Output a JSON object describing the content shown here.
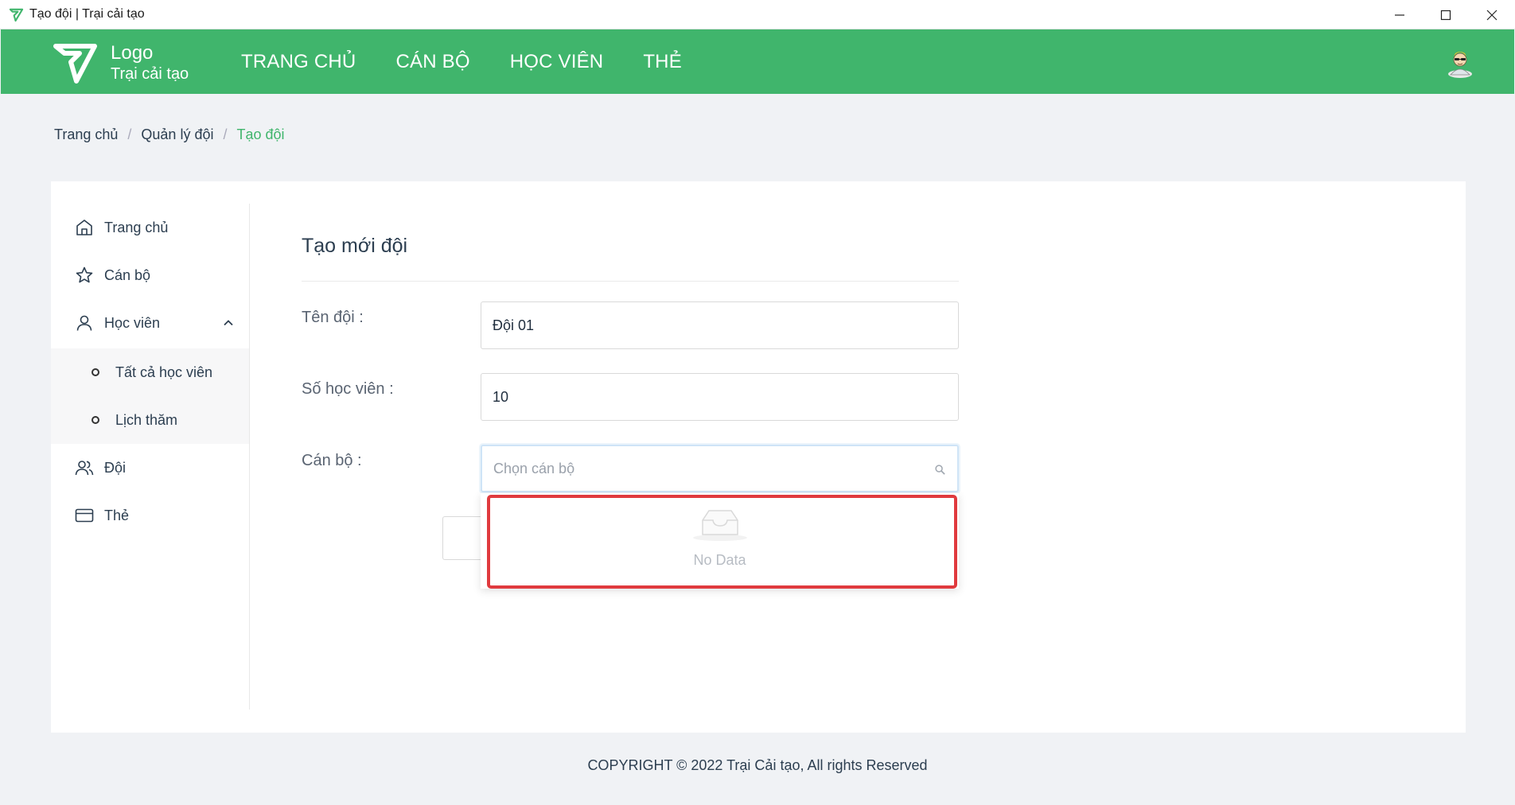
{
  "window": {
    "title": "Tạo đội | Trại cải tạo",
    "icon": "app-logo-icon",
    "controls": [
      "minimize-icon",
      "maximize-icon",
      "close-icon"
    ]
  },
  "header": {
    "logo_title": "Logo",
    "logo_subtitle": "Trại cải tạo",
    "nav": [
      "TRANG CHỦ",
      "CÁN BỘ",
      "HỌC VIÊN",
      "THẺ"
    ],
    "avatar": "avatar-icon",
    "background": "#40b56c"
  },
  "breadcrumb": {
    "items": [
      "Trang chủ",
      "Quản lý đội"
    ],
    "separator": "/",
    "current": "Tạo đội"
  },
  "sidebar": {
    "items": [
      {
        "label": "Trang chủ",
        "icon": "home-icon"
      },
      {
        "label": "Cán bộ",
        "icon": "star-icon"
      },
      {
        "label": "Học viên",
        "icon": "user-icon",
        "expanded": true
      },
      {
        "label": "Đội",
        "icon": "users-icon"
      },
      {
        "label": "Thẻ",
        "icon": "card-icon"
      }
    ],
    "subitems": [
      "Tất cả học viên",
      "Lịch thăm"
    ]
  },
  "form": {
    "title": "Tạo mới đội",
    "fields": [
      {
        "label": "Tên đội :",
        "value": "Đội 01"
      },
      {
        "label": "Số học viên :",
        "value": "10"
      },
      {
        "label": "Cán bộ :",
        "placeholder": "Chọn cán bộ"
      }
    ]
  },
  "dropdown": {
    "empty_text": "No Data",
    "highlight_color": "#e03a3e"
  },
  "footer": {
    "text": "COPYRIGHT © 2022 Trại Cải tạo, All rights Reserved"
  }
}
